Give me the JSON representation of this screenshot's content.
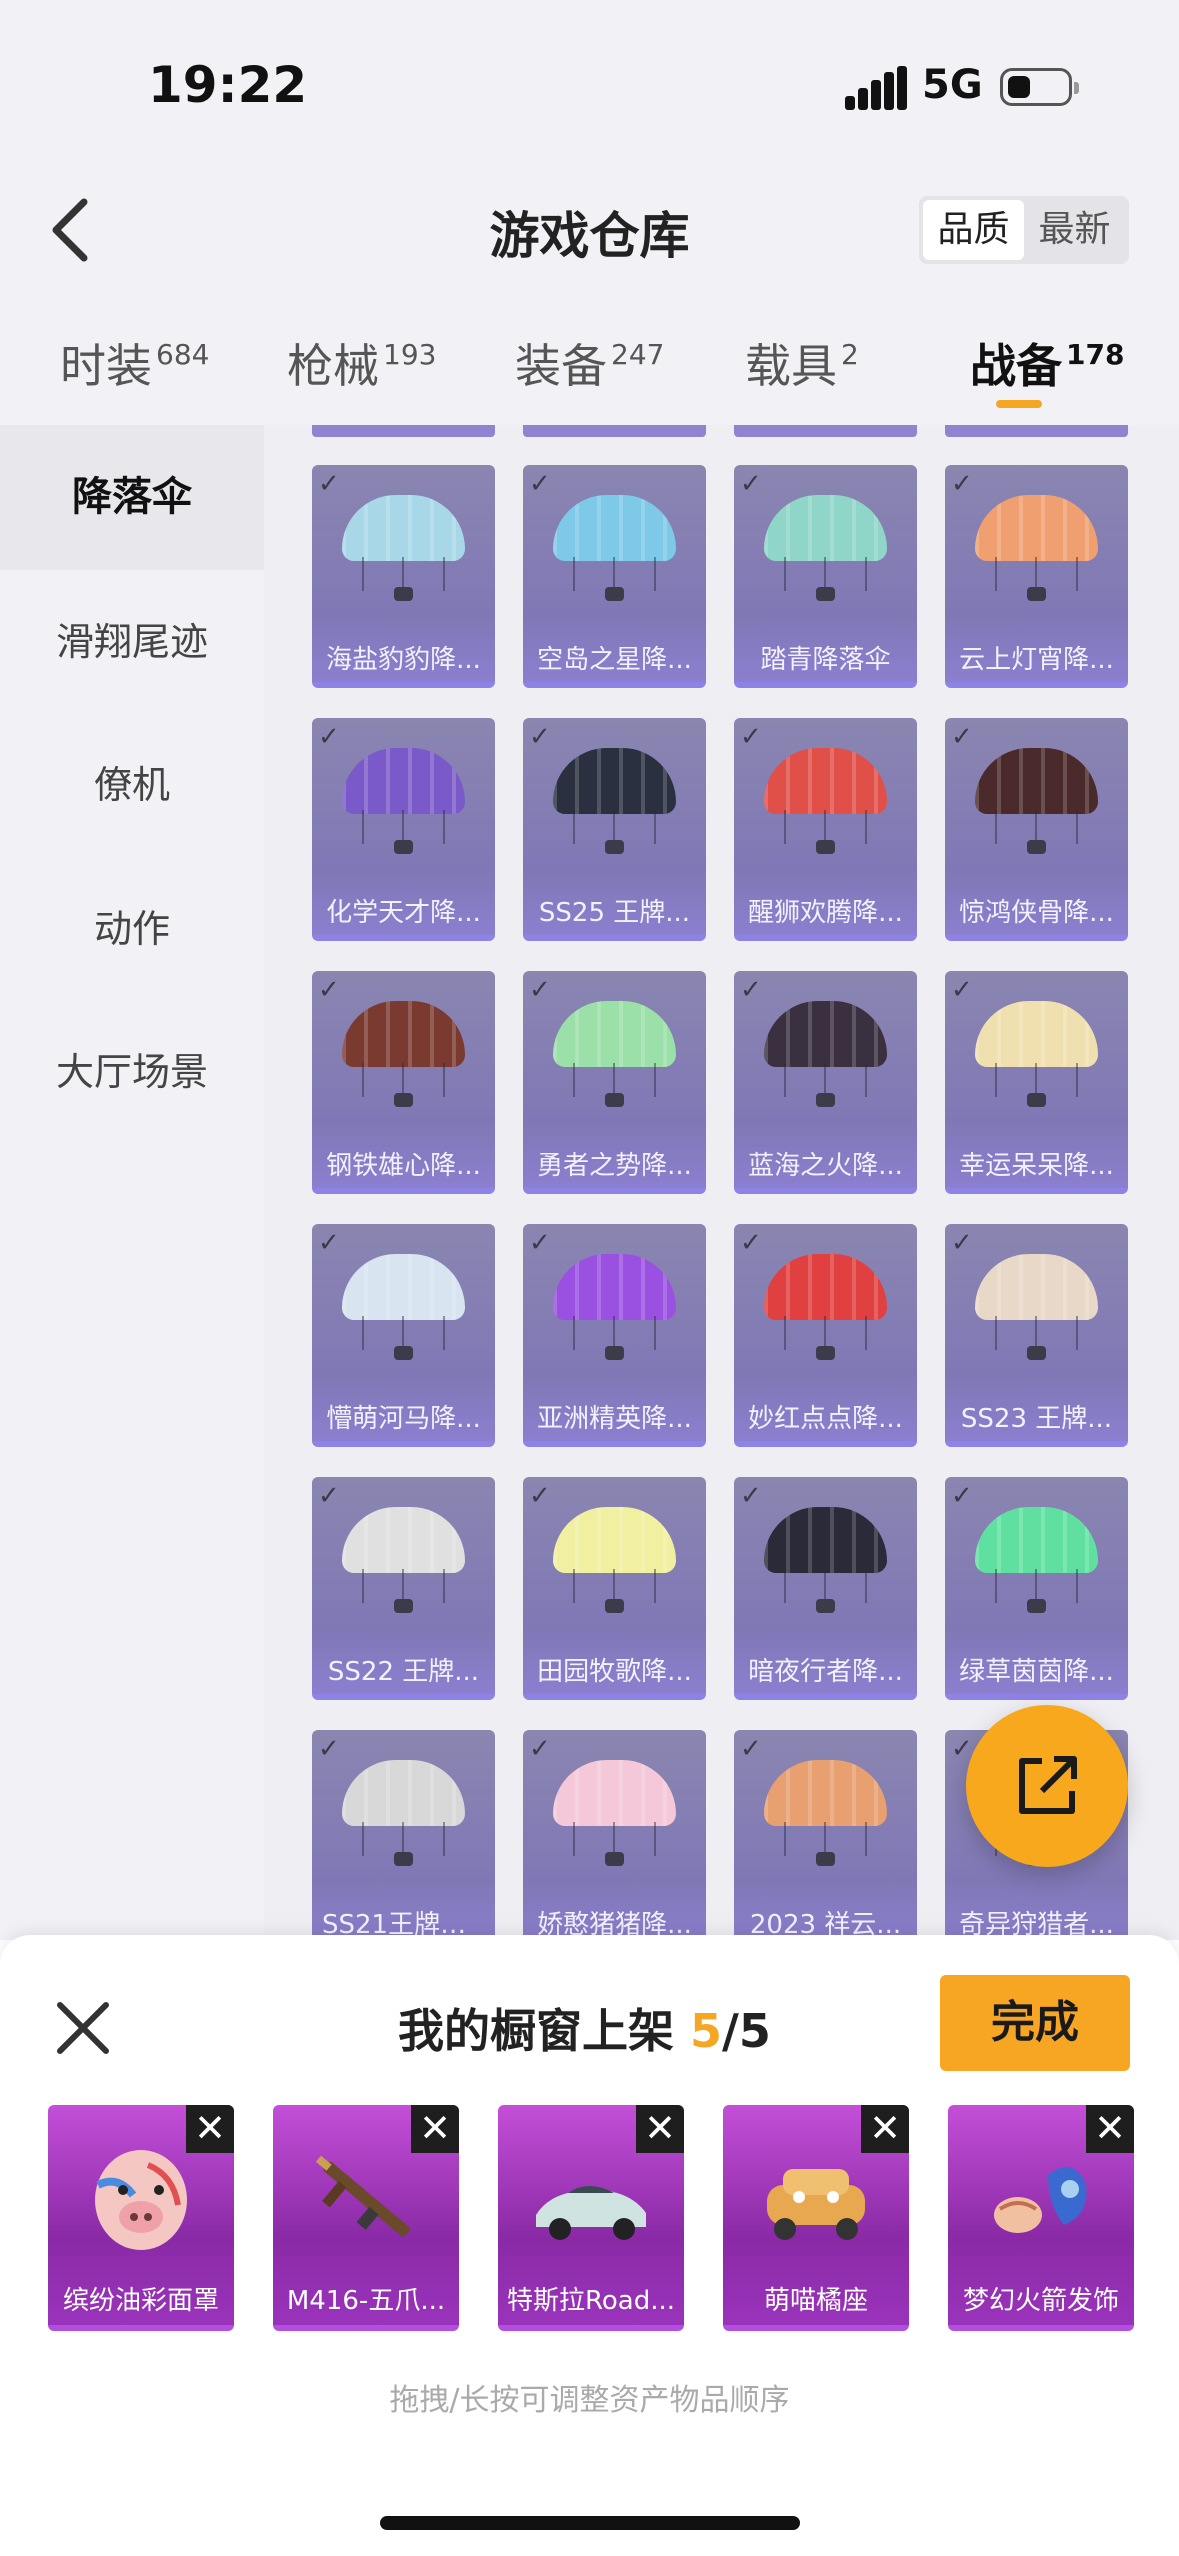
{
  "status_bar": {
    "time": "19:22",
    "network": "5G"
  },
  "header": {
    "title": "游戏仓库",
    "sort_options": [
      "品质",
      "最新"
    ],
    "sort_selected": "品质"
  },
  "tabs": [
    {
      "label": "时装",
      "count": "684"
    },
    {
      "label": "枪械",
      "count": "193"
    },
    {
      "label": "装备",
      "count": "247"
    },
    {
      "label": "载具",
      "count": "2"
    },
    {
      "label": "战备",
      "count": "178",
      "active": true
    }
  ],
  "sidebar": {
    "items": [
      "降落伞",
      "滑翔尾迹",
      "僚机",
      "动作",
      "大厅场景"
    ],
    "active": "降落伞"
  },
  "grid": {
    "items": [
      {
        "label": "海盐豹豹降...",
        "color": "#a8d8e8"
      },
      {
        "label": "空岛之星降...",
        "color": "#7ec8e8"
      },
      {
        "label": "踏青降落伞",
        "color": "#8fd6c8"
      },
      {
        "label": "云上灯宵降...",
        "color": "#f0a070"
      },
      {
        "label": "化学天才降...",
        "color": "#7a5ac8"
      },
      {
        "label": "SS25 王牌...",
        "color": "#2a3040"
      },
      {
        "label": "醒狮欢腾降...",
        "color": "#e05048"
      },
      {
        "label": "惊鸿侠骨降...",
        "color": "#4a2a2a"
      },
      {
        "label": "钢铁雄心降...",
        "color": "#7a3a30"
      },
      {
        "label": "勇者之势降...",
        "color": "#9ae0a8"
      },
      {
        "label": "蓝海之火降...",
        "color": "#3a3040"
      },
      {
        "label": "幸运呆呆降...",
        "color": "#f0e0b0"
      },
      {
        "label": "懵萌河马降...",
        "color": "#d8e4f0"
      },
      {
        "label": "亚洲精英降...",
        "color": "#9a50e0"
      },
      {
        "label": "妙红点点降...",
        "color": "#e04040"
      },
      {
        "label": "SS23 王牌...",
        "color": "#e8d8c8"
      },
      {
        "label": "SS22 王牌...",
        "color": "#e0e0e0"
      },
      {
        "label": "田园牧歌降...",
        "color": "#f0f0a0"
      },
      {
        "label": "暗夜行者降...",
        "color": "#2a2a38"
      },
      {
        "label": "绿草茵茵降...",
        "color": "#60e0a0"
      },
      {
        "label": "SS21王牌降...",
        "color": "#d8d8d8"
      },
      {
        "label": "娇憨猪猪降...",
        "color": "#f4c8d8"
      },
      {
        "label": "2023 祥云...",
        "color": "#e8a070"
      },
      {
        "label": "奇异狩猎者...",
        "color": "#c8c0e8"
      }
    ]
  },
  "panel": {
    "title": "我的橱窗上架",
    "count_current": "5",
    "count_total": "/5",
    "done_label": "完成",
    "hint": "拖拽/长按可调整资产物品顺序",
    "items": [
      {
        "label": "缤纷油彩面罩",
        "icon": "mask-icon"
      },
      {
        "label": "M416-五爪...",
        "icon": "rifle-icon"
      },
      {
        "label": "特斯拉Road...",
        "icon": "car-icon"
      },
      {
        "label": "萌喵橘座",
        "icon": "vehicle-icon"
      },
      {
        "label": "梦幻火箭发饰",
        "icon": "hair-accessory-icon"
      }
    ]
  },
  "colors": {
    "accent": "#f5a623",
    "card_purple": "#8078b6",
    "slot_purple": "#a33ec0"
  }
}
